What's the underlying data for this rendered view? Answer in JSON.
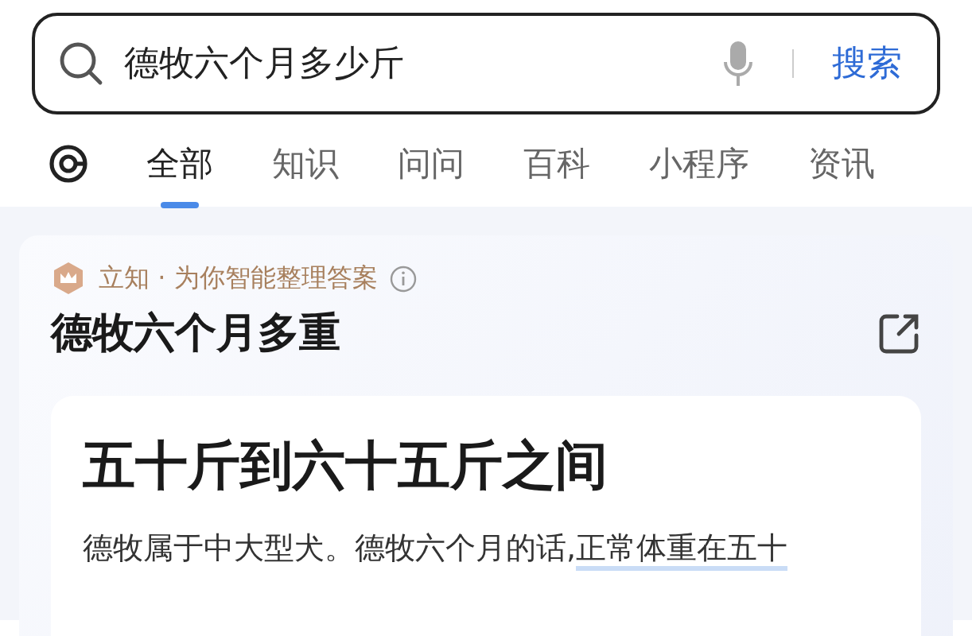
{
  "search": {
    "value": "德牧六个月多少斤",
    "button": "搜索"
  },
  "tabs": [
    {
      "label": "全部",
      "selected": true
    },
    {
      "label": "知识",
      "selected": false
    },
    {
      "label": "问问",
      "selected": false
    },
    {
      "label": "百科",
      "selected": false
    },
    {
      "label": "小程序",
      "selected": false
    },
    {
      "label": "资讯",
      "selected": false
    }
  ],
  "answer_card": {
    "source": "立知 · 为你智能整理答案",
    "title": "德牧六个月多重",
    "headline": "五十斤到六十五斤之间",
    "paragraph": {
      "text": "德牧属于中大型犬。德牧六个月的话,",
      "highlight": "正常体重在五十"
    }
  }
}
